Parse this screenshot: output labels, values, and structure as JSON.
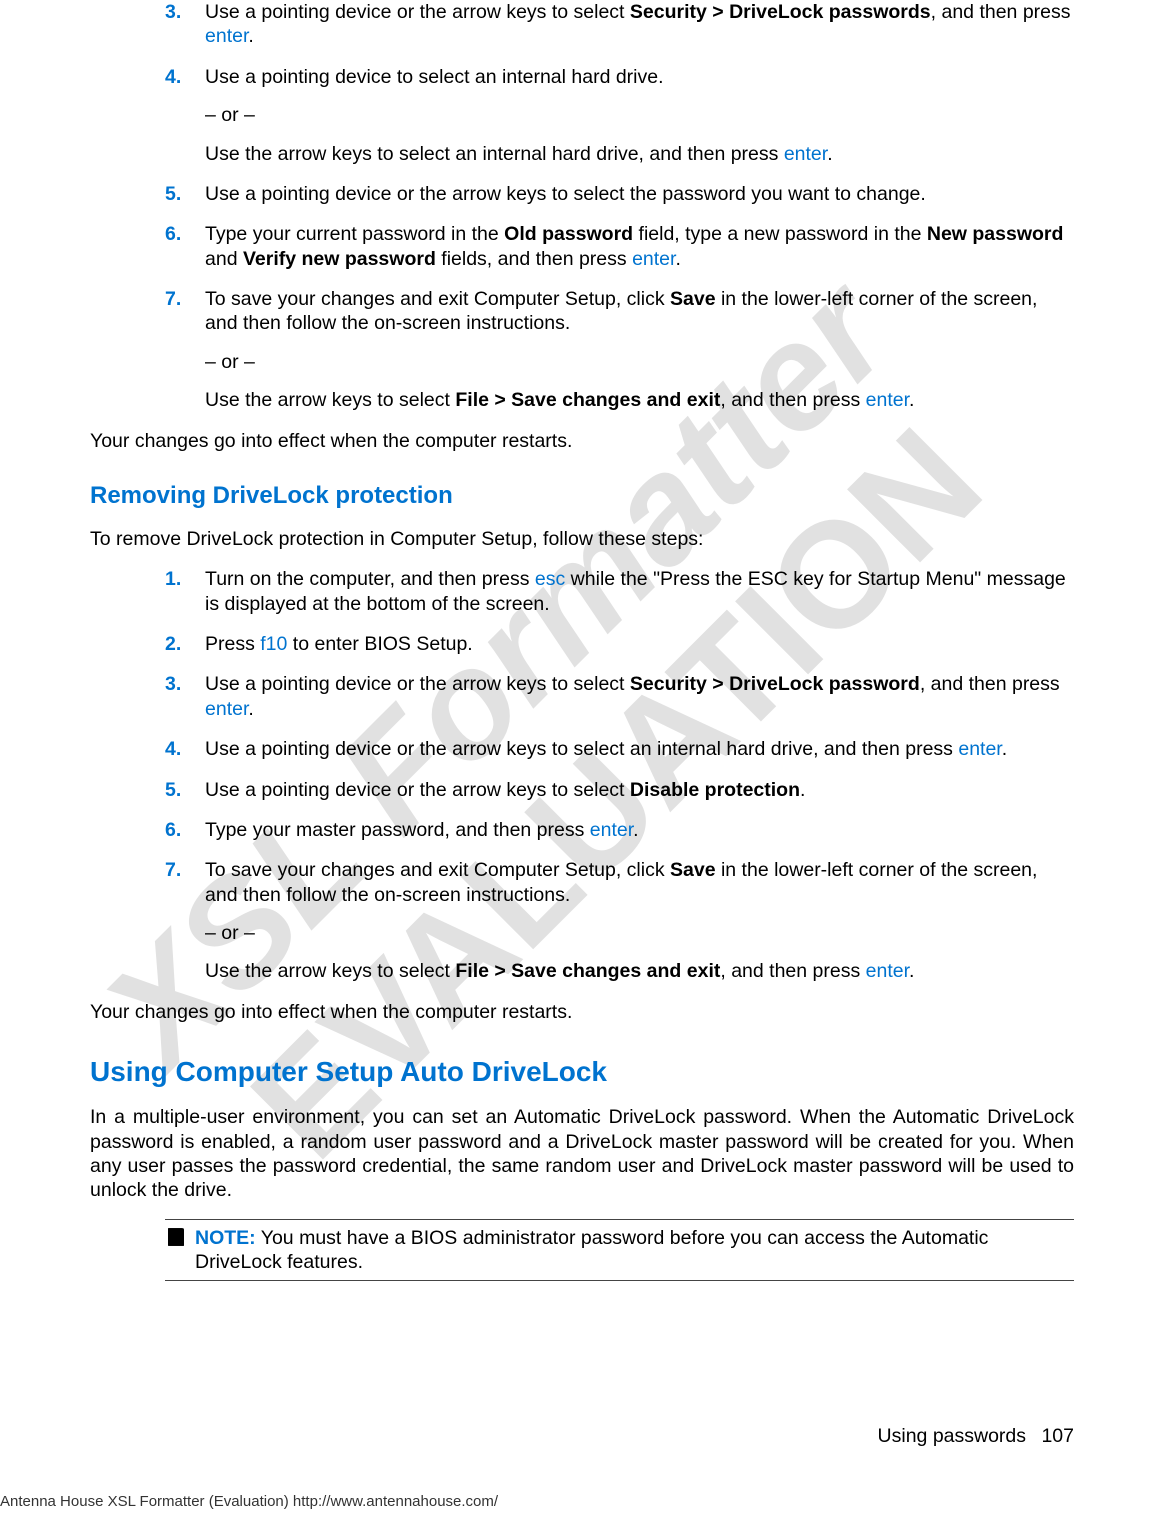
{
  "section1": {
    "items": [
      {
        "num": "3.",
        "paras": [
          {
            "runs": [
              {
                "t": "Use a pointing device or the arrow keys to select "
              },
              {
                "t": "Security > DriveLock passwords",
                "b": true
              },
              {
                "t": ", and then press "
              },
              {
                "t": "enter",
                "k": true
              },
              {
                "t": "."
              }
            ]
          }
        ]
      },
      {
        "num": "4.",
        "paras": [
          {
            "runs": [
              {
                "t": "Use a pointing device to select an internal hard drive."
              }
            ]
          },
          {
            "runs": [
              {
                "t": "– or –"
              }
            ]
          },
          {
            "runs": [
              {
                "t": "Use the arrow keys to select an internal hard drive, and then press "
              },
              {
                "t": "enter",
                "k": true
              },
              {
                "t": "."
              }
            ]
          }
        ]
      },
      {
        "num": "5.",
        "paras": [
          {
            "runs": [
              {
                "t": "Use a pointing device or the arrow keys to select the password you want to change."
              }
            ]
          }
        ]
      },
      {
        "num": "6.",
        "paras": [
          {
            "runs": [
              {
                "t": "Type your current password in the "
              },
              {
                "t": "Old password",
                "b": true
              },
              {
                "t": " field, type a new password in the "
              },
              {
                "t": "New password",
                "b": true
              },
              {
                "t": " and "
              },
              {
                "t": "Verify new password",
                "b": true
              },
              {
                "t": " fields, and then press "
              },
              {
                "t": "enter",
                "k": true
              },
              {
                "t": "."
              }
            ]
          }
        ]
      },
      {
        "num": "7.",
        "paras": [
          {
            "runs": [
              {
                "t": "To save your changes and exit Computer Setup, click "
              },
              {
                "t": "Save",
                "b": true
              },
              {
                "t": " in the lower-left corner of the screen, and then follow the on-screen instructions."
              }
            ]
          },
          {
            "runs": [
              {
                "t": "– or –"
              }
            ]
          },
          {
            "runs": [
              {
                "t": "Use the arrow keys to select "
              },
              {
                "t": "File > Save changes and exit",
                "b": true
              },
              {
                "t": ", and then press "
              },
              {
                "t": "enter",
                "k": true
              },
              {
                "t": "."
              }
            ]
          }
        ]
      }
    ],
    "closing": "Your changes go into effect when the computer restarts."
  },
  "heading_remove": "Removing DriveLock protection",
  "remove_intro": "To remove DriveLock protection in Computer Setup, follow these steps:",
  "section2": {
    "items": [
      {
        "num": "1.",
        "paras": [
          {
            "runs": [
              {
                "t": "Turn on the computer, and then press "
              },
              {
                "t": "esc",
                "k": true
              },
              {
                "t": " while the \"Press the ESC key for Startup Menu\" message is displayed at the bottom of the screen."
              }
            ]
          }
        ]
      },
      {
        "num": "2.",
        "paras": [
          {
            "runs": [
              {
                "t": "Press "
              },
              {
                "t": "f10",
                "k": true
              },
              {
                "t": " to enter BIOS Setup."
              }
            ]
          }
        ]
      },
      {
        "num": "3.",
        "paras": [
          {
            "runs": [
              {
                "t": "Use a pointing device or the arrow keys to select "
              },
              {
                "t": "Security > DriveLock password",
                "b": true
              },
              {
                "t": ", and then press "
              },
              {
                "t": "enter",
                "k": true
              },
              {
                "t": "."
              }
            ]
          }
        ]
      },
      {
        "num": "4.",
        "paras": [
          {
            "runs": [
              {
                "t": "Use a pointing device or the arrow keys to select an internal hard drive, and then press "
              },
              {
                "t": "enter",
                "k": true
              },
              {
                "t": "."
              }
            ]
          }
        ]
      },
      {
        "num": "5.",
        "paras": [
          {
            "runs": [
              {
                "t": "Use a pointing device or the arrow keys to select "
              },
              {
                "t": "Disable protection",
                "b": true
              },
              {
                "t": "."
              }
            ]
          }
        ]
      },
      {
        "num": "6.",
        "paras": [
          {
            "runs": [
              {
                "t": "Type your master password, and then press "
              },
              {
                "t": "enter",
                "k": true
              },
              {
                "t": "."
              }
            ]
          }
        ]
      },
      {
        "num": "7.",
        "paras": [
          {
            "runs": [
              {
                "t": "To save your changes and exit Computer Setup, click "
              },
              {
                "t": "Save",
                "b": true
              },
              {
                "t": " in the lower-left corner of the screen, and then follow the on-screen instructions."
              }
            ]
          },
          {
            "runs": [
              {
                "t": "– or –"
              }
            ]
          },
          {
            "runs": [
              {
                "t": "Use the arrow keys to select "
              },
              {
                "t": "File > Save changes and exit",
                "b": true
              },
              {
                "t": ", and then press "
              },
              {
                "t": "enter",
                "k": true
              },
              {
                "t": "."
              }
            ]
          }
        ]
      }
    ],
    "closing": "Your changes go into effect when the computer restarts."
  },
  "heading_auto": "Using Computer Setup Auto DriveLock",
  "auto_intro": "In a multiple-user environment, you can set an Automatic DriveLock password. When the Automatic DriveLock password is enabled, a random user password and a DriveLock master password will be created for you. When any user passes the password credential, the same random user and DriveLock master password will be used to unlock the drive.",
  "note": {
    "label": "NOTE:",
    "text": "You must have a BIOS administrator password before you can access the Automatic DriveLock features."
  },
  "footer": {
    "section": "Using passwords",
    "page": "107"
  },
  "eval_footer": "Antenna House XSL Formatter (Evaluation)  http://www.antennahouse.com/",
  "watermark": {
    "line1": "XSL Formatter",
    "line2": "EVALUATION"
  }
}
